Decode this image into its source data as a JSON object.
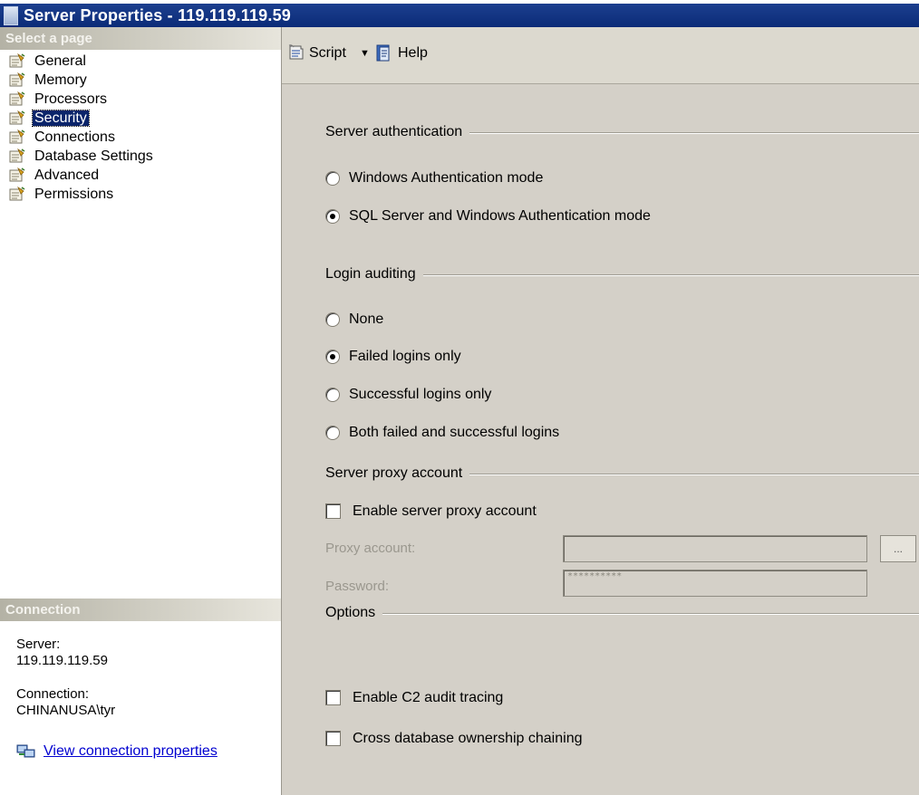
{
  "window": {
    "title": "Server Properties - 119.119.119.59"
  },
  "left_pane": {
    "select_page_header": "Select a page",
    "pages": [
      {
        "label": "General",
        "selected": false
      },
      {
        "label": "Memory",
        "selected": false
      },
      {
        "label": "Processors",
        "selected": false
      },
      {
        "label": "Security",
        "selected": true
      },
      {
        "label": "Connections",
        "selected": false
      },
      {
        "label": "Database Settings",
        "selected": false
      },
      {
        "label": "Advanced",
        "selected": false
      },
      {
        "label": "Permissions",
        "selected": false
      }
    ],
    "connection_header": "Connection",
    "server_label": "Server:",
    "server_value": "119.119.119.59",
    "connection_label": "Connection:",
    "connection_value": "CHINANUSA\\tyr",
    "view_connection_properties": "View connection properties"
  },
  "toolbar": {
    "script_label": "Script",
    "help_label": "Help"
  },
  "security": {
    "server_authentication": {
      "heading": "Server authentication",
      "options": [
        {
          "label": "Windows Authentication mode",
          "selected": false
        },
        {
          "label": "SQL Server and Windows Authentication mode",
          "selected": true
        }
      ]
    },
    "login_auditing": {
      "heading": "Login auditing",
      "options": [
        {
          "label": "None",
          "selected": false
        },
        {
          "label": "Failed logins only",
          "selected": true
        },
        {
          "label": "Successful logins only",
          "selected": false
        },
        {
          "label": "Both failed and successful logins",
          "selected": false
        }
      ]
    },
    "server_proxy_account": {
      "heading": "Server proxy account",
      "enable_label": "Enable server proxy account",
      "enable_checked": false,
      "proxy_account_label": "Proxy account:",
      "proxy_account_value": "",
      "password_label": "Password:",
      "password_value": "**********",
      "browse_label": "..."
    },
    "options": {
      "heading": "Options",
      "items": [
        {
          "label": "Enable C2 audit tracing",
          "checked": false
        },
        {
          "label": "Cross database ownership chaining",
          "checked": false
        }
      ]
    }
  }
}
